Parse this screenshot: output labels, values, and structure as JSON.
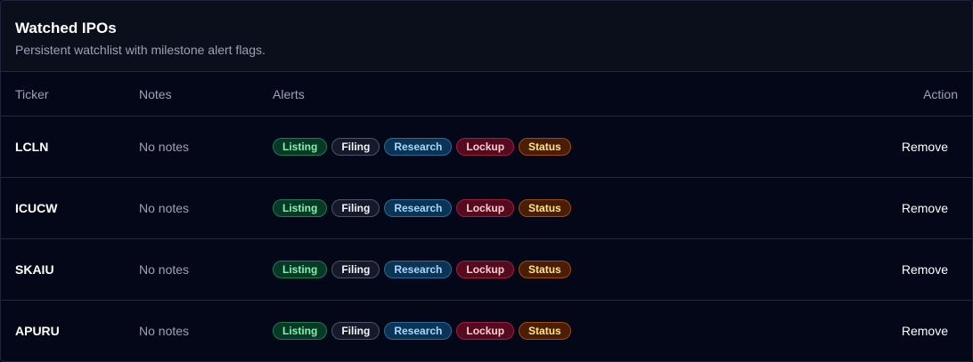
{
  "panel": {
    "title": "Watched IPOs",
    "subtitle": "Persistent watchlist with milestone alert flags."
  },
  "table": {
    "headers": {
      "ticker": "Ticker",
      "notes": "Notes",
      "alerts": "Alerts",
      "action": "Action"
    },
    "rows": [
      {
        "ticker": "LCLN",
        "notes": "No notes",
        "alerts": [
          "Listing",
          "Filing",
          "Research",
          "Lockup",
          "Status"
        ],
        "action": "Remove"
      },
      {
        "ticker": "ICUCW",
        "notes": "No notes",
        "alerts": [
          "Listing",
          "Filing",
          "Research",
          "Lockup",
          "Status"
        ],
        "action": "Remove"
      },
      {
        "ticker": "SKAIU",
        "notes": "No notes",
        "alerts": [
          "Listing",
          "Filing",
          "Research",
          "Lockup",
          "Status"
        ],
        "action": "Remove"
      },
      {
        "ticker": "APURU",
        "notes": "No notes",
        "alerts": [
          "Listing",
          "Filing",
          "Research",
          "Lockup",
          "Status"
        ],
        "action": "Remove"
      }
    ]
  },
  "colors": {
    "background": "#030718",
    "header_background": "#0b0f1c",
    "listing": "#86efac",
    "filing": "#f2f4f8",
    "research": "#a5d8ff",
    "lockup": "#fecdd3",
    "status": "#fde68a"
  }
}
